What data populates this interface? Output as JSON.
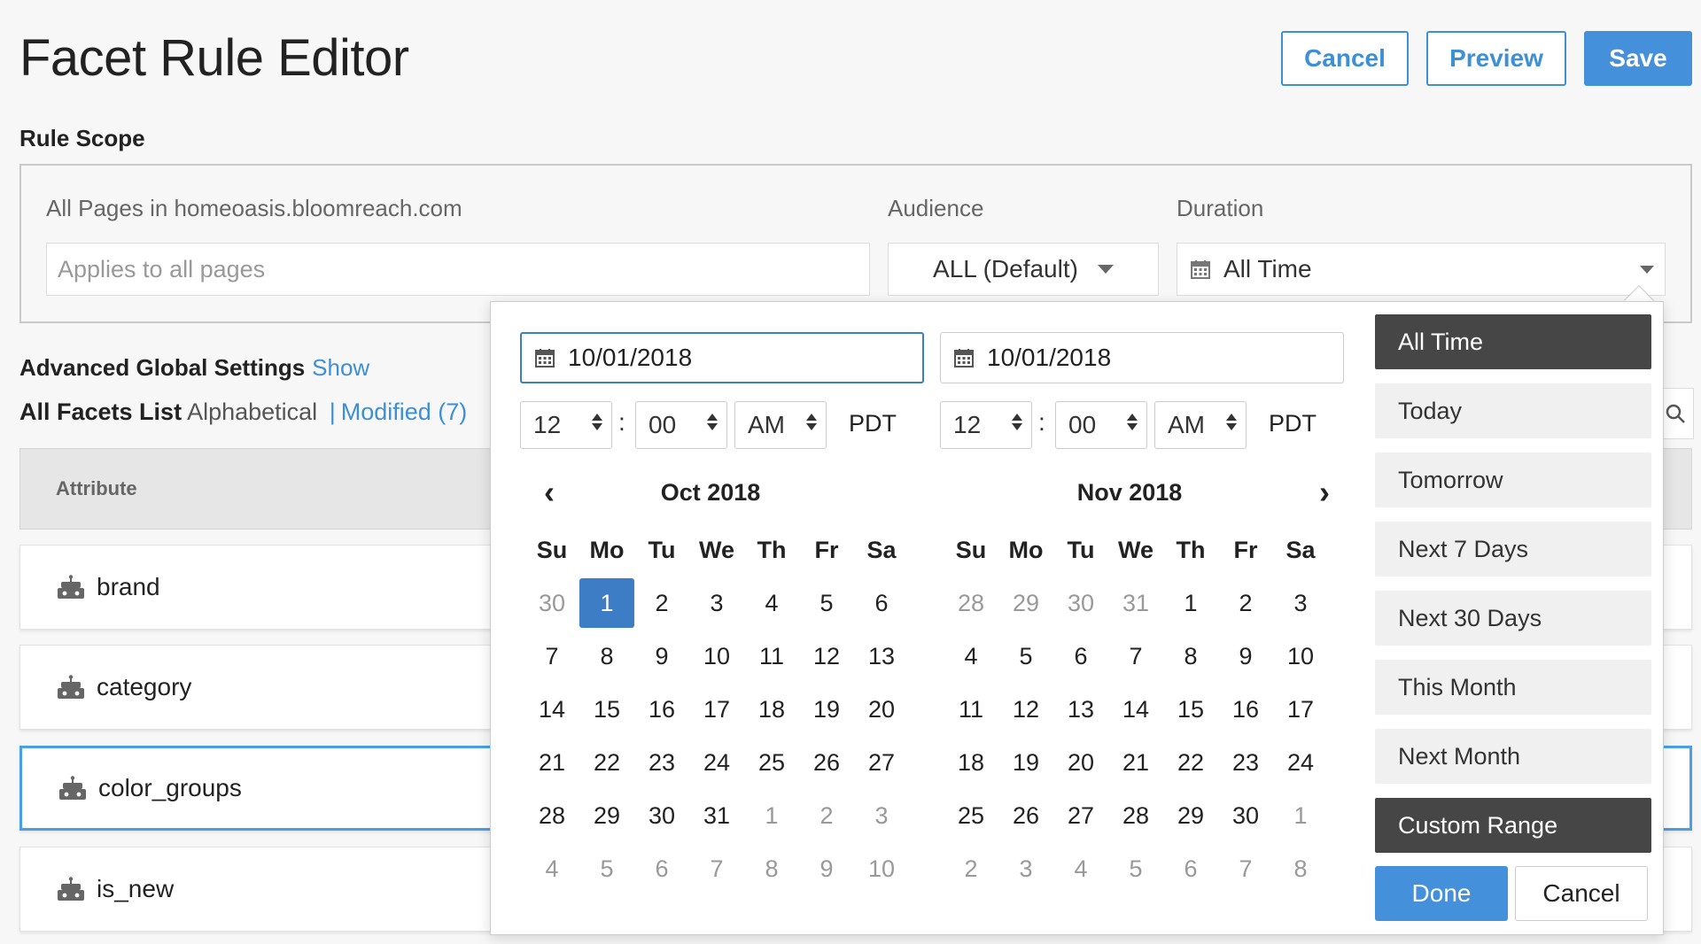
{
  "header": {
    "title": "Facet Rule Editor",
    "cancel_label": "Cancel",
    "preview_label": "Preview",
    "save_label": "Save"
  },
  "rule_scope": {
    "label": "Rule Scope",
    "pages_label": "All Pages in homeoasis.bloomreach.com",
    "pages_placeholder": "Applies to all pages",
    "audience_label": "Audience",
    "audience_value": "ALL (Default)",
    "duration_label": "Duration",
    "duration_value": "All Time"
  },
  "advanced": {
    "label": "Advanced Global Settings",
    "show_link": "Show"
  },
  "facets": {
    "list_label": "All Facets List",
    "sort_label": "Alphabetical",
    "separator": "|",
    "modified_label": "Modified (7)",
    "column_attribute": "Attribute",
    "rows": [
      {
        "name": "brand",
        "selected": false
      },
      {
        "name": "category",
        "selected": false
      },
      {
        "name": "color_groups",
        "selected": true
      },
      {
        "name": "is_new",
        "selected": false
      }
    ]
  },
  "duration_picker": {
    "start_date": "10/01/2018",
    "end_date": "10/01/2018",
    "start_time": {
      "hour": "12",
      "minute": "00",
      "ampm": "AM",
      "tz": "PDT"
    },
    "end_time": {
      "hour": "12",
      "minute": "00",
      "ampm": "AM",
      "tz": "PDT"
    },
    "weekdays": [
      "Su",
      "Mo",
      "Tu",
      "We",
      "Th",
      "Fr",
      "Sa"
    ],
    "months": [
      {
        "title": "Oct 2018",
        "days": [
          [
            "30",
            "off"
          ],
          [
            "1",
            "sel"
          ],
          [
            "2",
            ""
          ],
          [
            "3",
            ""
          ],
          [
            "4",
            ""
          ],
          [
            "5",
            ""
          ],
          [
            "6",
            ""
          ],
          [
            "7",
            ""
          ],
          [
            "8",
            ""
          ],
          [
            "9",
            ""
          ],
          [
            "10",
            ""
          ],
          [
            "11",
            ""
          ],
          [
            "12",
            ""
          ],
          [
            "13",
            ""
          ],
          [
            "14",
            ""
          ],
          [
            "15",
            ""
          ],
          [
            "16",
            ""
          ],
          [
            "17",
            ""
          ],
          [
            "18",
            ""
          ],
          [
            "19",
            ""
          ],
          [
            "20",
            ""
          ],
          [
            "21",
            ""
          ],
          [
            "22",
            ""
          ],
          [
            "23",
            ""
          ],
          [
            "24",
            ""
          ],
          [
            "25",
            ""
          ],
          [
            "26",
            ""
          ],
          [
            "27",
            ""
          ],
          [
            "28",
            ""
          ],
          [
            "29",
            ""
          ],
          [
            "30",
            ""
          ],
          [
            "31",
            ""
          ],
          [
            "1",
            "off"
          ],
          [
            "2",
            "off"
          ],
          [
            "3",
            "off"
          ],
          [
            "4",
            "off"
          ],
          [
            "5",
            "off"
          ],
          [
            "6",
            "off"
          ],
          [
            "7",
            "off"
          ],
          [
            "8",
            "off"
          ],
          [
            "9",
            "off"
          ],
          [
            "10",
            "off"
          ]
        ]
      },
      {
        "title": "Nov 2018",
        "days": [
          [
            "28",
            "off"
          ],
          [
            "29",
            "off"
          ],
          [
            "30",
            "off"
          ],
          [
            "31",
            "off"
          ],
          [
            "1",
            ""
          ],
          [
            "2",
            ""
          ],
          [
            "3",
            ""
          ],
          [
            "4",
            ""
          ],
          [
            "5",
            ""
          ],
          [
            "6",
            ""
          ],
          [
            "7",
            ""
          ],
          [
            "8",
            ""
          ],
          [
            "9",
            ""
          ],
          [
            "10",
            ""
          ],
          [
            "11",
            ""
          ],
          [
            "12",
            ""
          ],
          [
            "13",
            ""
          ],
          [
            "14",
            ""
          ],
          [
            "15",
            ""
          ],
          [
            "16",
            ""
          ],
          [
            "17",
            ""
          ],
          [
            "18",
            ""
          ],
          [
            "19",
            ""
          ],
          [
            "20",
            ""
          ],
          [
            "21",
            ""
          ],
          [
            "22",
            ""
          ],
          [
            "23",
            ""
          ],
          [
            "24",
            ""
          ],
          [
            "25",
            ""
          ],
          [
            "26",
            ""
          ],
          [
            "27",
            ""
          ],
          [
            "28",
            ""
          ],
          [
            "29",
            ""
          ],
          [
            "30",
            ""
          ],
          [
            "1",
            "off"
          ],
          [
            "2",
            "off"
          ],
          [
            "3",
            "off"
          ],
          [
            "4",
            "off"
          ],
          [
            "5",
            "off"
          ],
          [
            "6",
            "off"
          ],
          [
            "7",
            "off"
          ],
          [
            "8",
            "off"
          ]
        ]
      }
    ],
    "ranges": [
      {
        "label": "All Time",
        "active": true
      },
      {
        "label": "Today",
        "active": false
      },
      {
        "label": "Tomorrow",
        "active": false
      },
      {
        "label": "Next 7 Days",
        "active": false
      },
      {
        "label": "Next 30 Days",
        "active": false
      },
      {
        "label": "This Month",
        "active": false
      },
      {
        "label": "Next Month",
        "active": false
      },
      {
        "label": "Custom Range",
        "active": true
      }
    ],
    "done_label": "Done",
    "cancel_label": "Cancel"
  },
  "icons": {
    "calendar": "calendar-icon",
    "robot": "robot-icon",
    "search": "search-icon"
  },
  "colors": {
    "accent": "#3d8fd6",
    "selected_day": "#3d7dc6",
    "dark_range": "#464646"
  }
}
